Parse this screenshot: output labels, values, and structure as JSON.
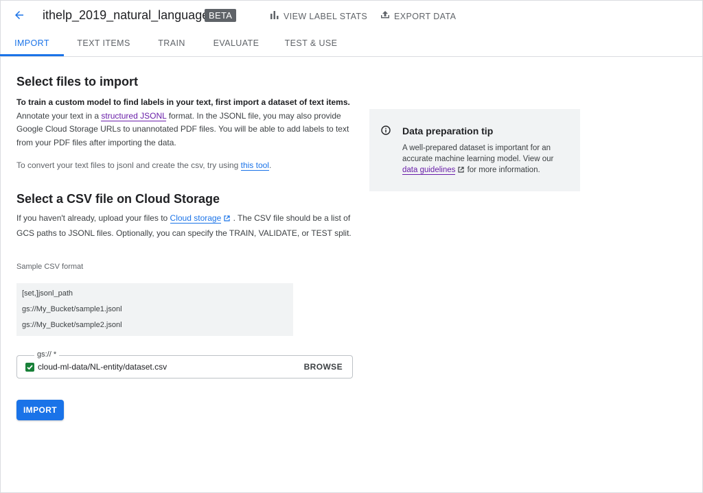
{
  "header": {
    "title": "ithelp_2019_natural_language",
    "badge": "BETA",
    "actions": [
      {
        "label": "VIEW LABEL STATS",
        "icon": "bar-chart-icon"
      },
      {
        "label": "EXPORT DATA",
        "icon": "upload-icon"
      }
    ]
  },
  "tabs": [
    {
      "label": "IMPORT",
      "active": true
    },
    {
      "label": "TEXT ITEMS",
      "active": false
    },
    {
      "label": "TRAIN",
      "active": false
    },
    {
      "label": "EVALUATE",
      "active": false
    },
    {
      "label": "TEST & USE",
      "active": false
    }
  ],
  "select_files": {
    "heading": "Select files to import",
    "intro_bold": "To train a custom model to find labels in your text, first import a dataset of text items.",
    "intro_pre_link": "Annotate your text in a",
    "intro_link": "structured JSONL",
    "intro_post_link": "format. In the JSONL file, you may also provide Google Cloud Storage URLs to unannotated PDF files. You will be able to add labels to text from your PDF files after importing the data.",
    "convert_pre_link": "To convert your text files to jsonl and create the csv, try using",
    "convert_link": "this tool",
    "convert_post_link": "."
  },
  "csv_section": {
    "heading": "Select a CSV file on Cloud Storage",
    "pre_link": "If you haven't already, upload your files to",
    "link": "Cloud storage",
    "post_link": ". The CSV file should be a list of GCS paths to JSONL files. Optionally, you can specify the TRAIN, VALIDATE, or TEST split.",
    "sample_label": "Sample CSV format",
    "sample_lines": [
      "[set,]jsonl_path",
      "gs://My_Bucket/sample1.jsonl",
      "gs://My_Bucket/sample2.jsonl"
    ]
  },
  "gcs_field": {
    "label": "gs:// *",
    "value": "cloud-ml-data/NL-entity/dataset.csv",
    "browse_label": "BROWSE"
  },
  "import_button": "IMPORT",
  "tip": {
    "title": "Data preparation tip",
    "body_pre_link": "A well-prepared dataset is important for an accurate machine learning model. View our",
    "link": "data guidelines",
    "body_post_link": "for more information."
  },
  "colors": {
    "accent": "#1a73e8",
    "visited_link": "#681da8",
    "check_green": "#188038",
    "tip_background": "#f1f3f4"
  }
}
